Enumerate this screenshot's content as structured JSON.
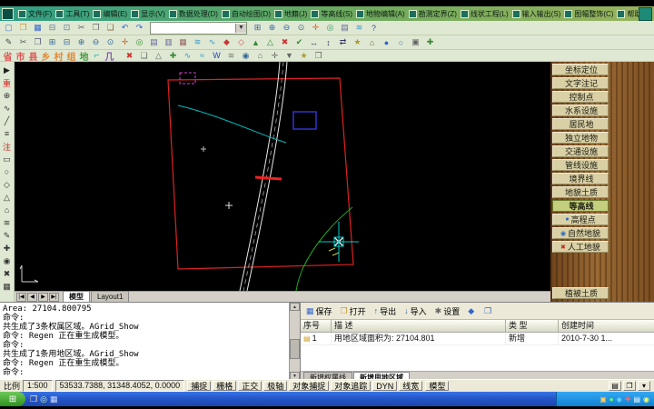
{
  "menu": {
    "items": [
      "文件(F)",
      "工具(T)",
      "编辑(E)",
      "显示(V)",
      "数据处理(D)",
      "自动绘图(D)",
      "地籍(J)",
      "等高线(S)",
      "地物编辑(A)",
      "勘测定界(Z)",
      "线状工程(L)",
      "输入输出(S)",
      "图幅整饰(C)",
      "帮助(H)"
    ]
  },
  "toolbar1": {
    "combo_value": "",
    "icons_before": [
      {
        "name": "new-file-icon",
        "glyph": "▢",
        "color": "#4477cc"
      },
      {
        "name": "open-folder-icon",
        "glyph": "❒",
        "color": "#cc9933"
      },
      {
        "name": "save-icon",
        "glyph": "▦",
        "color": "#3366cc"
      },
      {
        "name": "print-icon",
        "glyph": "⊟",
        "color": "#557799"
      },
      {
        "name": "preview-icon",
        "glyph": "⊡",
        "color": "#557799"
      },
      {
        "name": "cut-icon",
        "glyph": "✂",
        "color": "#666666"
      },
      {
        "name": "copy-icon",
        "glyph": "❐",
        "color": "#666666"
      },
      {
        "name": "paste-icon",
        "glyph": "❑",
        "color": "#886644"
      },
      {
        "name": "undo-icon",
        "glyph": "↶",
        "color": "#3366cc"
      },
      {
        "name": "redo-icon",
        "glyph": "↷",
        "color": "#3366cc"
      }
    ],
    "icons_after": [
      {
        "name": "zoom-window-icon",
        "glyph": "⊞",
        "color": "#336699"
      },
      {
        "name": "zoom-in-icon",
        "glyph": "⊕",
        "color": "#336699"
      },
      {
        "name": "zoom-out-icon",
        "glyph": "⊖",
        "color": "#336699"
      },
      {
        "name": "zoom-extents-icon",
        "glyph": "⊙",
        "color": "#336699"
      },
      {
        "name": "pan-icon",
        "glyph": "✛",
        "color": "#cc6633"
      },
      {
        "name": "regen-icon",
        "glyph": "◎",
        "color": "#339966"
      },
      {
        "name": "layers-icon",
        "glyph": "▤",
        "color": "#666699"
      },
      {
        "name": "match-props-icon",
        "glyph": "≋",
        "color": "#3399cc"
      },
      {
        "name": "help-icon",
        "glyph": "?",
        "color": "#335599"
      }
    ]
  },
  "toolbar2": {
    "icons": [
      {
        "name": "edit-icon",
        "glyph": "✎",
        "color": "#444444"
      },
      {
        "name": "cut-icon",
        "glyph": "✂",
        "color": "#555555"
      },
      {
        "name": "copy-icon",
        "glyph": "❐",
        "color": "#555577"
      },
      {
        "name": "zoom-window-icon",
        "glyph": "⊞",
        "color": "#336699"
      },
      {
        "name": "zoom-prev-icon",
        "glyph": "⊟",
        "color": "#336699"
      },
      {
        "name": "zoom-in-icon",
        "glyph": "⊕",
        "color": "#336699"
      },
      {
        "name": "zoom-out-icon",
        "glyph": "⊖",
        "color": "#336699"
      },
      {
        "name": "zoom-extents-icon",
        "glyph": "⊙",
        "color": "#336699"
      },
      {
        "name": "pan-icon",
        "glyph": "✛",
        "color": "#bb6633"
      },
      {
        "name": "regen-icon",
        "glyph": "◎",
        "color": "#339933"
      },
      {
        "name": "layers-icon",
        "glyph": "▤",
        "color": "#666699"
      },
      {
        "name": "linetype-icon",
        "glyph": "▥",
        "color": "#666699"
      },
      {
        "name": "hatch-icon",
        "glyph": "▦",
        "color": "#996666"
      },
      {
        "name": "polyline-icon",
        "glyph": "≋",
        "color": "#3399cc"
      },
      {
        "name": "spline-icon",
        "glyph": "∿",
        "color": "#3399cc"
      },
      {
        "name": "point-style-icon",
        "glyph": "◆",
        "color": "#cc3333"
      },
      {
        "name": "node-icon",
        "glyph": "◇",
        "color": "#cc5555"
      },
      {
        "name": "triangle-net-icon",
        "glyph": "▲",
        "color": "#338833"
      },
      {
        "name": "slope-icon",
        "glyph": "△",
        "color": "#338833"
      },
      {
        "name": "erase-icon",
        "glyph": "✖",
        "color": "#cc3333"
      },
      {
        "name": "confirm-icon",
        "glyph": "✔",
        "color": "#338833"
      },
      {
        "name": "stretch-icon",
        "glyph": "↔",
        "color": "#333366"
      },
      {
        "name": "scale-icon",
        "glyph": "↕",
        "color": "#333366"
      },
      {
        "name": "swap-icon",
        "glyph": "⇄",
        "color": "#333366"
      },
      {
        "name": "symbol-icon",
        "glyph": "★",
        "color": "#aa9933"
      },
      {
        "name": "home-icon",
        "glyph": "⌂",
        "color": "#666633"
      },
      {
        "name": "circle-icon",
        "glyph": "●",
        "color": "#3366cc"
      },
      {
        "name": "arc-icon",
        "glyph": "○",
        "color": "#3366cc"
      },
      {
        "name": "block-icon",
        "glyph": "▣",
        "color": "#666666"
      },
      {
        "name": "add-icon",
        "glyph": "✚",
        "color": "#338833"
      }
    ]
  },
  "toolbar3": {
    "text_buttons": [
      {
        "name": "province-button",
        "label": "省",
        "color": "#e05555"
      },
      {
        "name": "city-button",
        "label": "市",
        "color": "#e05555"
      },
      {
        "name": "county-button",
        "label": "县",
        "color": "#e05555"
      },
      {
        "name": "township-button",
        "label": "乡",
        "color": "#e08833"
      },
      {
        "name": "village-button",
        "label": "村",
        "color": "#e08833"
      },
      {
        "name": "group-button",
        "label": "组",
        "color": "#e08833"
      },
      {
        "name": "land-button",
        "label": "地",
        "color": "#44a044"
      },
      {
        "name": "corner-button",
        "label": "⌐",
        "color": "#00a8a8"
      },
      {
        "name": "ji-button",
        "label": "几",
        "color": "#8855bb"
      }
    ],
    "icons": [
      {
        "name": "delete-icon",
        "glyph": "✖",
        "color": "#cc3333"
      },
      {
        "name": "rect-icon",
        "glyph": "❏",
        "color": "#666666"
      },
      {
        "name": "triangle-icon",
        "glyph": "△",
        "color": "#666666"
      },
      {
        "name": "add-icon",
        "glyph": "✚",
        "color": "#338833"
      },
      {
        "name": "curve-icon",
        "glyph": "∿",
        "color": "#3399cc"
      },
      {
        "name": "wave-icon",
        "glyph": "≈",
        "color": "#3399cc"
      },
      {
        "name": "word-icon",
        "glyph": "W",
        "color": "#2244cc"
      },
      {
        "name": "multiline-icon",
        "glyph": "≋",
        "color": "#777777"
      },
      {
        "name": "target-icon",
        "glyph": "◉",
        "color": "#336699"
      },
      {
        "name": "house-icon",
        "glyph": "⌂",
        "color": "#666666"
      },
      {
        "name": "cross-icon",
        "glyph": "✛",
        "color": "#666666"
      },
      {
        "name": "down-icon",
        "glyph": "▼",
        "color": "#666666"
      },
      {
        "name": "star-icon",
        "glyph": "★",
        "color": "#aa9933"
      },
      {
        "name": "copy-icon",
        "glyph": "❐",
        "color": "#666666"
      }
    ]
  },
  "left_toolbar": {
    "icons": [
      {
        "name": "select-arrow-icon",
        "glyph": "▶",
        "color": "#222222"
      },
      {
        "name": "regen-icon",
        "glyph": "重",
        "color": "#cc2222"
      },
      {
        "name": "osnap-icon",
        "glyph": "⊕",
        "color": "#333333"
      },
      {
        "name": "curve-icon",
        "glyph": "∿",
        "color": "#333333"
      },
      {
        "name": "line-icon",
        "glyph": "╱",
        "color": "#333333"
      },
      {
        "name": "parallel-icon",
        "glyph": "≡",
        "color": "#333333"
      },
      {
        "name": "annotate-icon",
        "glyph": "注",
        "color": "#cc2222"
      },
      {
        "name": "rect-icon",
        "glyph": "▭",
        "color": "#333333"
      },
      {
        "name": "circle-icon",
        "glyph": "○",
        "color": "#333333"
      },
      {
        "name": "diamond-icon",
        "glyph": "◇",
        "color": "#333333"
      },
      {
        "name": "triangle-icon",
        "glyph": "△",
        "color": "#333333"
      },
      {
        "name": "house-icon",
        "glyph": "⌂",
        "color": "#333333"
      },
      {
        "name": "wave-icon",
        "glyph": "≋",
        "color": "#333333"
      },
      {
        "name": "pencil-icon",
        "glyph": "✎",
        "color": "#333333"
      },
      {
        "name": "plus-icon",
        "glyph": "✚",
        "color": "#333333"
      },
      {
        "name": "point-icon",
        "glyph": "◉",
        "color": "#333333"
      },
      {
        "name": "erase-icon",
        "glyph": "✖",
        "color": "#333333"
      },
      {
        "name": "hatch-icon",
        "glyph": "▦",
        "color": "#333333"
      }
    ]
  },
  "canvas": {
    "colors": {
      "boundary": "#dd2222",
      "road": "#e8e8e8",
      "stream": "#00bbbb",
      "contour": "#22aa22",
      "marker": "#00cccc",
      "block": "#3333cc",
      "highlight": "#ee2222"
    }
  },
  "sidebar": {
    "buttons": [
      {
        "name": "sidebar-item-coord-locate",
        "label": "坐标定位"
      },
      {
        "name": "sidebar-item-text-annotation",
        "label": "文字注记"
      },
      {
        "name": "sidebar-item-control-point",
        "label": "控制点"
      },
      {
        "name": "sidebar-item-water-facility",
        "label": "水系设施"
      },
      {
        "name": "sidebar-item-residential",
        "label": "居民地"
      },
      {
        "name": "sidebar-item-independent-feature",
        "label": "独立地物"
      },
      {
        "name": "sidebar-item-traffic-facility",
        "label": "交通设施"
      },
      {
        "name": "sidebar-item-pipeline-facility",
        "label": "管线设施"
      },
      {
        "name": "sidebar-item-boundary-line",
        "label": "境界线"
      },
      {
        "name": "sidebar-item-landform-soil",
        "label": "地貌土质"
      },
      {
        "name": "sidebar-item-contour-line",
        "label": "等高线",
        "cls": "active"
      },
      {
        "name": "sidebar-item-elevation-point",
        "label": "高程点",
        "icon": "●",
        "icon_color": "#2266cc"
      },
      {
        "name": "sidebar-item-natural-landform",
        "label": "自然地貌",
        "icon": "◉",
        "icon_color": "#2266cc"
      },
      {
        "name": "sidebar-item-artificial-landform",
        "label": "人工地貌",
        "icon": "✖",
        "icon_color": "#cc2222"
      },
      {
        "name": "sidebar-item-vegetation-soil",
        "label": "植被土质",
        "cls": "push-bottom"
      }
    ]
  },
  "model_tabs": {
    "nav_icons": [
      {
        "name": "first-tab-icon",
        "glyph": "|◀"
      },
      {
        "name": "prev-tab-icon",
        "glyph": "◀"
      },
      {
        "name": "next-tab-icon",
        "glyph": "▶"
      },
      {
        "name": "last-tab-icon",
        "glyph": "▶|"
      }
    ],
    "tabs": [
      {
        "name": "tab-model",
        "label": "模型",
        "cls": "active"
      },
      {
        "name": "tab-layout1",
        "label": "Layout1"
      }
    ]
  },
  "command": {
    "lines": [
      "Area: 27104.800795",
      "命令:",
      "共生成了3条权属区域。AGrid_Show",
      "命令: Regen 正在重生成模型。",
      "命令:",
      "共生成了1条用地区域。AGrid_Show",
      "命令: Regen 正在重生成模型。",
      "命令:"
    ]
  },
  "table_panel": {
    "toolbar": [
      {
        "name": "save-button",
        "label": "保存",
        "glyph": "▦",
        "color": "#3366cc"
      },
      {
        "name": "open-button",
        "label": "打开",
        "glyph": "❒",
        "color": "#cc9933"
      },
      {
        "name": "export-button",
        "label": "导出",
        "glyph": "↑",
        "color": "#336699"
      },
      {
        "name": "import-button",
        "label": "导入",
        "glyph": "↓",
        "color": "#336699"
      },
      {
        "name": "settings-button",
        "label": "设置",
        "glyph": "✱",
        "color": "#666666"
      },
      {
        "name": "mark-button",
        "label": "",
        "glyph": "◆",
        "color": "#3366cc"
      },
      {
        "name": "list-button",
        "label": "",
        "glyph": "❐",
        "color": "#3366cc"
      }
    ],
    "columns": [
      "序号",
      "描 述",
      "类 型",
      "创建时间"
    ],
    "rows": [
      {
        "no": "1",
        "desc": "用地区域面积为: 27104.801",
        "type": "新增",
        "time": "2010-7-30 1..."
      }
    ],
    "tabs": [
      {
        "name": "tab-new-ownership-line",
        "label": "新增权属线"
      },
      {
        "name": "tab-new-land-area",
        "label": "新增用地区域",
        "cls": "active"
      }
    ]
  },
  "status_bar": {
    "scale_label": "比例",
    "scale_value": "1:500",
    "coords": "53533.7388, 31348.4052, 0.0000",
    "toggles": [
      {
        "name": "toggle-snap",
        "label": "捕捉"
      },
      {
        "name": "toggle-grid",
        "label": "栅格"
      },
      {
        "name": "toggle-ortho",
        "label": "正交"
      },
      {
        "name": "toggle-polar",
        "label": "极轴"
      },
      {
        "name": "toggle-osnap",
        "label": "对象捕捉"
      },
      {
        "name": "toggle-otrack",
        "label": "对象追踪"
      },
      {
        "name": "toggle-dyn",
        "label": "DYN"
      },
      {
        "name": "toggle-lineweight",
        "label": "线宽"
      }
    ],
    "model_label": "模型",
    "right_icons": [
      {
        "name": "tray-layout-icon",
        "glyph": "▤"
      },
      {
        "name": "tray-copy-icon",
        "glyph": "❐"
      },
      {
        "name": "tray-menu-icon",
        "glyph": "▾"
      }
    ]
  },
  "taskbar": {
    "start_glyph": "⊞",
    "quick_icons": [
      {
        "name": "quick-folder-icon",
        "glyph": "❒",
        "color": "#ffeeaa"
      },
      {
        "name": "quick-app-icon",
        "glyph": "◎",
        "color": "#ccffcc"
      },
      {
        "name": "quick-doc-icon",
        "glyph": "▦",
        "color": "#ccddff"
      }
    ],
    "tray_icons": [
      {
        "name": "tray-volume-icon",
        "glyph": "▣",
        "color": "#ffcc66"
      },
      {
        "name": "tray-network-icon",
        "glyph": "●",
        "color": "#66ff66"
      },
      {
        "name": "tray-shield-icon",
        "glyph": "◆",
        "color": "#66ccff"
      },
      {
        "name": "tray-health-icon",
        "glyph": "✚",
        "color": "#ff6666"
      },
      {
        "name": "tray-msg-icon",
        "glyph": "▤",
        "color": "#ffffff"
      },
      {
        "name": "tray-clock-icon",
        "glyph": "◉",
        "color": "#ffff66"
      }
    ]
  }
}
